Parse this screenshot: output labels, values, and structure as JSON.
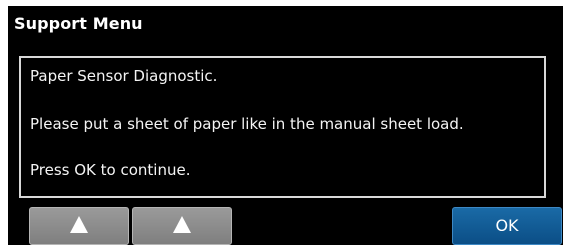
{
  "header": {
    "title": "Support Menu"
  },
  "message": {
    "line1": "Paper Sensor Diagnostic.",
    "line2": "Please put a sheet of paper like in the manual sheet load.",
    "line3": "Press OK to continue."
  },
  "buttons": {
    "up1_icon": "up-arrow",
    "up2_icon": "up-arrow",
    "ok_label": "OK"
  },
  "colors": {
    "background": "#000000",
    "ok_button": "#0b4e86",
    "arrow_button": "#8a8a8a"
  }
}
